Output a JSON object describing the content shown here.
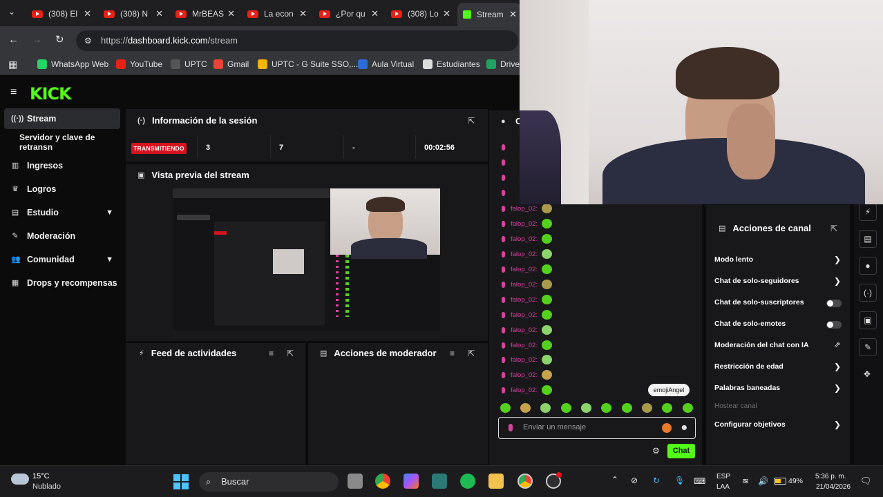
{
  "browser": {
    "tabs": [
      {
        "title": "(308) El"
      },
      {
        "title": "(308) N"
      },
      {
        "title": "MrBEAS"
      },
      {
        "title": "La econ"
      },
      {
        "title": "¿Por qu"
      },
      {
        "title": "(308) Lo"
      },
      {
        "title": "Stream"
      }
    ],
    "url_prefix": "https://",
    "url_host": "dashboard.kick.com",
    "url_path": "/stream",
    "bookmarks": [
      {
        "label": "WhatsApp Web",
        "color": "#25d366"
      },
      {
        "label": "YouTube",
        "color": "#e62117"
      },
      {
        "label": "UPTC",
        "color": "#555555"
      },
      {
        "label": "Gmail",
        "color": "#ea4335"
      },
      {
        "label": "UPTC - G Suite SSO,...",
        "color": "#f4b400"
      },
      {
        "label": "Aula Virtual",
        "color": "#2b6cd6"
      },
      {
        "label": "Estudiantes",
        "color": "#dddddd"
      },
      {
        "label": "Drive",
        "color": "#1ea362"
      }
    ]
  },
  "app": {
    "logo": "KICK",
    "sidebar": [
      {
        "label": "Stream",
        "icon": "signal-icon"
      },
      {
        "label": "Servidor y clave de retransn",
        "icon": ""
      },
      {
        "label": "Ingresos",
        "icon": "bank-icon"
      },
      {
        "label": "Logros",
        "icon": "trophy-icon"
      },
      {
        "label": "Estudio",
        "icon": "layout-icon"
      },
      {
        "label": "Moderación",
        "icon": "wrench-icon"
      },
      {
        "label": "Comunidad",
        "icon": "users-icon"
      },
      {
        "label": "Drops y recompensas",
        "icon": "gift-icon"
      }
    ],
    "session": {
      "title": "Información de la sesión",
      "live_badge": "TRANSMITIENDO",
      "stats": [
        "3",
        "7",
        "-",
        "00:02:56"
      ]
    },
    "preview_title": "Vista previa del stream",
    "activity_title": "Feed de actividades",
    "modactions_title": "Acciones de moderador",
    "chat": {
      "header_initial": "C",
      "username": "falop_02:",
      "input_placeholder": "Enviar un mensaje",
      "send_label": "Chat",
      "tooltip": "emojiAngel"
    },
    "channel_actions": {
      "title": "Acciones de canal",
      "items": [
        {
          "label": "Modo lento",
          "control": "chevron"
        },
        {
          "label": "Chat de solo-seguidores",
          "control": "chevron"
        },
        {
          "label": "Chat de solo-suscriptores",
          "control": "toggle"
        },
        {
          "label": "Chat de solo-emotes",
          "control": "toggle"
        },
        {
          "label": "Moderación del chat con IA",
          "control": "external"
        },
        {
          "label": "Restricción de edad",
          "control": "chevron"
        },
        {
          "label": "Palabras baneadas",
          "control": "chevron"
        },
        {
          "label": "Hostear canal",
          "control": "none"
        },
        {
          "label": "Configurar objetivos",
          "control": "chevron"
        }
      ]
    }
  },
  "taskbar": {
    "weather_temp": "15°C",
    "weather_desc": "Nublado",
    "search_label": "Buscar",
    "lang_1": "ESP",
    "lang_2": "LAA",
    "battery": "49%",
    "time": "5:36 p. m.",
    "date": "21/04/2026"
  }
}
